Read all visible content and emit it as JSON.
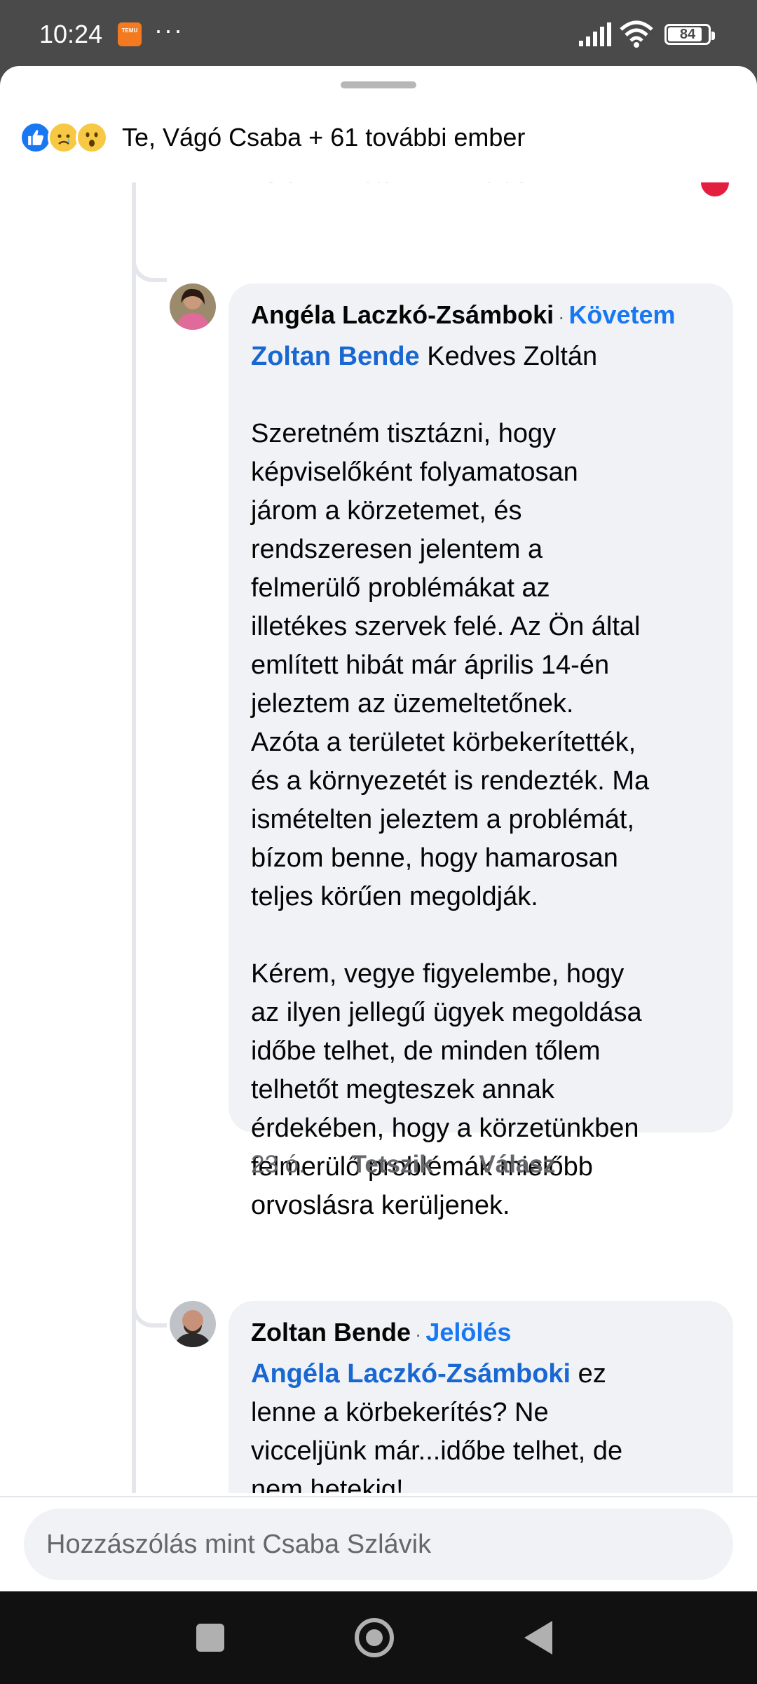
{
  "status_bar": {
    "time": "10:24",
    "app_icon_text": "TEMU",
    "more": "···",
    "battery": "84"
  },
  "reactions": {
    "icons": [
      "like-icon",
      "sad-icon",
      "wow-icon"
    ],
    "summary": "Te, Vágó Csaba + 61 további ember"
  },
  "cut_comment_meta": {
    "time": "23 ó.",
    "like": "Tetszik",
    "reply": "Válasz"
  },
  "comments": [
    {
      "author": "Angéla Laczkó-Zsámboki",
      "separator": "·",
      "action": "Követem",
      "mention": "Zoltan Bende",
      "text_after_mention": " Kedves Zoltán",
      "body": "Szeretném tisztázni, hogy\nképviselőként folyamatosan\njárom a körzetemet, és\nrendszeresen jelentem a\nfelmerülő problémákat az\nilletékes szervek felé. Az Ön által\nemlített hibát már április 14-én\njeleztem az üzemeltetőnek.\nAzóta a területet körbekerítették,\nés a környezetét is rendezték. Ma\nismételten jeleztem a problémát,\nbízom benne, hogy hamarosan\nteljes körűen megoldják.\n\nKérem, vegye figyelembe, hogy\naz ilyen jellegű ügyek megoldása\nidőbe telhet, de minden tőlem\ntelhetőt megteszek annak\nérdekében, hogy a körzetünkben\nfelmerülő problémák mielőbb\norvoslásra kerüljenek.",
      "time": "23 ó.",
      "like": "Tetszik",
      "reply": "Válasz"
    },
    {
      "author": "Zoltan Bende",
      "separator": "·",
      "action": "Jelölés",
      "mention": "Angéla Laczkó-Zsámboki",
      "text_after_mention": " ez",
      "body": "lenne a körbekerítés? Ne\nvicceljünk már...időbe telhet, de\nnem hetekig!\nTehát rendszeresen járja a\nkörzetét, akkor tegye már"
    }
  ],
  "composer": {
    "placeholder": "Hozzászólás mint Csaba Szlávik"
  },
  "colors": {
    "accent": "#1877f2",
    "bubble": "#f0f2f5",
    "meta": "#65676b"
  }
}
